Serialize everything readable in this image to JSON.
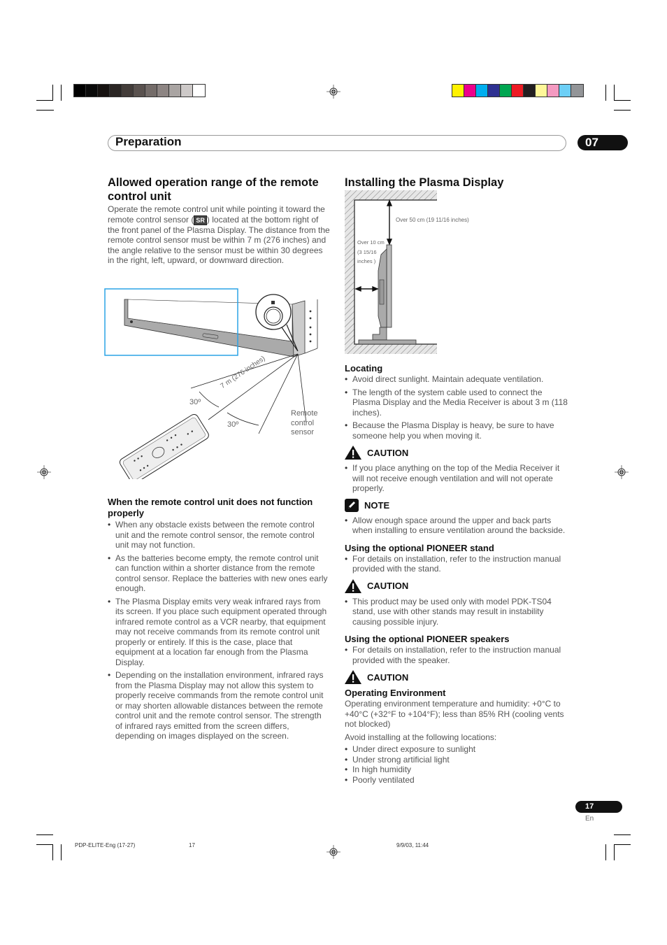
{
  "header": {
    "section_title": "Preparation",
    "chapter_number": "07"
  },
  "color_bars": {
    "grayscale": [
      "#000000",
      "#0a0a0a",
      "#161210",
      "#2a2523",
      "#433c39",
      "#5a524f",
      "#746c69",
      "#8d8583",
      "#a9a4a2",
      "#cdc9c8",
      "#ffffff"
    ],
    "process": [
      "#fff200",
      "#ec008c",
      "#00aeef",
      "#2e3192",
      "#00a651",
      "#ed1c24",
      "#231f20",
      "#fff799",
      "#f49ac1",
      "#6dcff6",
      "#939598"
    ]
  },
  "left": {
    "title": "Allowed operation range of the remote control unit",
    "intro_before_sr": "Operate the remote control unit while pointing it toward the remote control sensor (",
    "sr_badge": "SR",
    "intro_after_sr": ") located at the bottom right of the front panel of the Plasma Display. The distance from the remote control sensor must be within 7 m (276 inches) and the angle relative to the sensor must be within 30 degrees in the right, left, upward, or downward direction.",
    "diagram": {
      "distance_label": "7 m (276 inches)",
      "angle_left": "30º",
      "angle_right": "30º",
      "sensor_label_1": "Remote",
      "sensor_label_2": "control",
      "sensor_label_3": "sensor"
    },
    "trouble": {
      "title": "When the remote control unit does not function properly",
      "items": [
        "When any obstacle exists between the remote control unit and the remote control sensor, the remote control unit may not function.",
        "As the batteries become empty, the remote control unit can function within a shorter distance from the remote control sensor. Replace the batteries with new ones early enough.",
        "The Plasma Display emits very weak infrared rays from its screen. If you place such equipment operated through infrared remote control as a VCR nearby, that equipment may not receive commands from its remote control unit properly or entirely. If this is the case, place that equipment at a location far enough from the Plasma Display.",
        "Depending on the installation environment, infrared rays from the Plasma Display may not allow this system to properly receive commands from the remote control unit or may shorten allowable distances between the remote control unit and the remote control sensor. The strength of infrared rays emitted from the screen differs, depending on images displayed on the screen."
      ]
    }
  },
  "right": {
    "title": "Installing the Plasma Display",
    "diagram": {
      "top_clearance": "Over 50 cm (19 11/16 inches)",
      "back_clearance_1": "Over 10 cm",
      "back_clearance_2": "(3 15/16",
      "back_clearance_3": "inches )"
    },
    "locating": {
      "title": "Locating",
      "items": [
        "Avoid direct sunlight. Maintain adequate ventilation.",
        "The length of the system cable used to connect the Plasma Display and the Media Receiver is about 3 m (118 inches).",
        "Because the Plasma Display is heavy, be sure to have someone help you when moving it."
      ]
    },
    "caution1": {
      "label": "CAUTION",
      "items": [
        "If you place anything on the top of the Media Receiver it will not receive enough ventilation and will not operate properly."
      ]
    },
    "note": {
      "label": "NOTE",
      "items": [
        "Allow enough space around the upper and back parts when installing to ensure ventilation around the backside."
      ]
    },
    "stand": {
      "title": "Using the optional PIONEER stand",
      "items": [
        "For details on installation, refer to the instruction manual provided with the stand."
      ]
    },
    "caution2": {
      "label": "CAUTION",
      "items": [
        "This product may be used only with model PDK-TS04 stand, use with other stands may result in instability causing possible injury."
      ]
    },
    "speakers": {
      "title": "Using the optional PIONEER speakers",
      "items": [
        "For details on installation, refer to the instruction manual provided with the speaker."
      ]
    },
    "caution3": {
      "label": "CAUTION"
    },
    "environment": {
      "title": "Operating Environment",
      "text": "Operating environment temperature and humidity: +0°C to +40°C (+32°F to +104°F); less than 85% RH (cooling vents not blocked)",
      "avoid_intro": "Avoid installing at the following locations:",
      "items": [
        "Under direct exposure to sunlight",
        "Under strong artificial light",
        "In high humidity",
        "Poorly ventilated"
      ]
    }
  },
  "page": {
    "number": "17",
    "lang": "En"
  },
  "footer": {
    "file": "PDP-ELITE-Eng (17-27)",
    "page": "17",
    "timestamp": "9/9/03, 11:44"
  }
}
